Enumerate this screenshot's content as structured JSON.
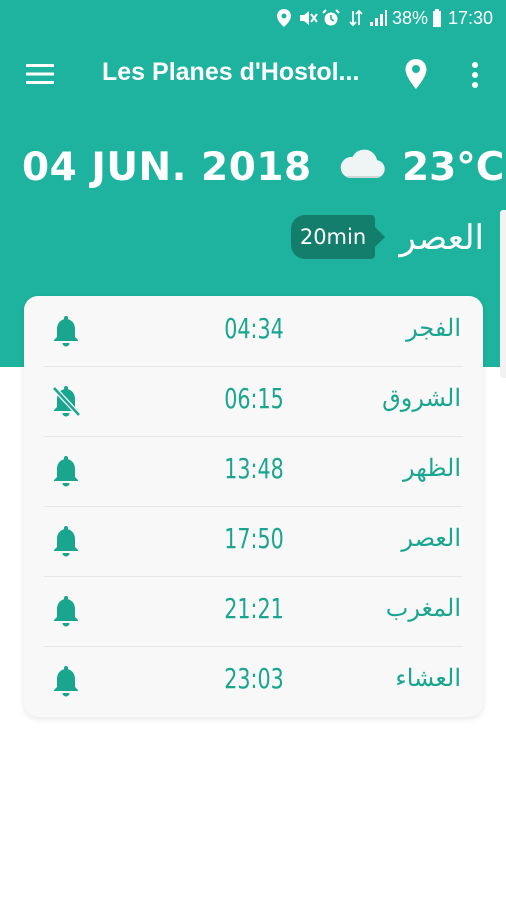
{
  "status_bar": {
    "battery": "38%",
    "time": "17:30",
    "icons": [
      "location-icon",
      "mute-icon",
      "alarm-icon",
      "data-icon",
      "signal-icon",
      "battery-icon"
    ]
  },
  "app_bar": {
    "title": "Les Planes d'Hostol..."
  },
  "header": {
    "date": "04 JUN. 2018",
    "temperature": "23°C",
    "weather_icon": "cloud-icon",
    "remaining": "20min",
    "next_prayer": "العصر"
  },
  "prayers": [
    {
      "name": "الفجر",
      "time": "04:34",
      "alarm": "on"
    },
    {
      "name": "الشروق",
      "time": "06:15",
      "alarm": "off"
    },
    {
      "name": "الظهر",
      "time": "13:48",
      "alarm": "on"
    },
    {
      "name": "العصر",
      "time": "17:50",
      "alarm": "on"
    },
    {
      "name": "المغرب",
      "time": "21:21",
      "alarm": "on"
    },
    {
      "name": "العشاء",
      "time": "23:03",
      "alarm": "on"
    }
  ],
  "colors": {
    "primary": "#1db39e",
    "badge": "#147e6d",
    "text_accent": "#1aa58f",
    "card": "#f8f8f8"
  }
}
